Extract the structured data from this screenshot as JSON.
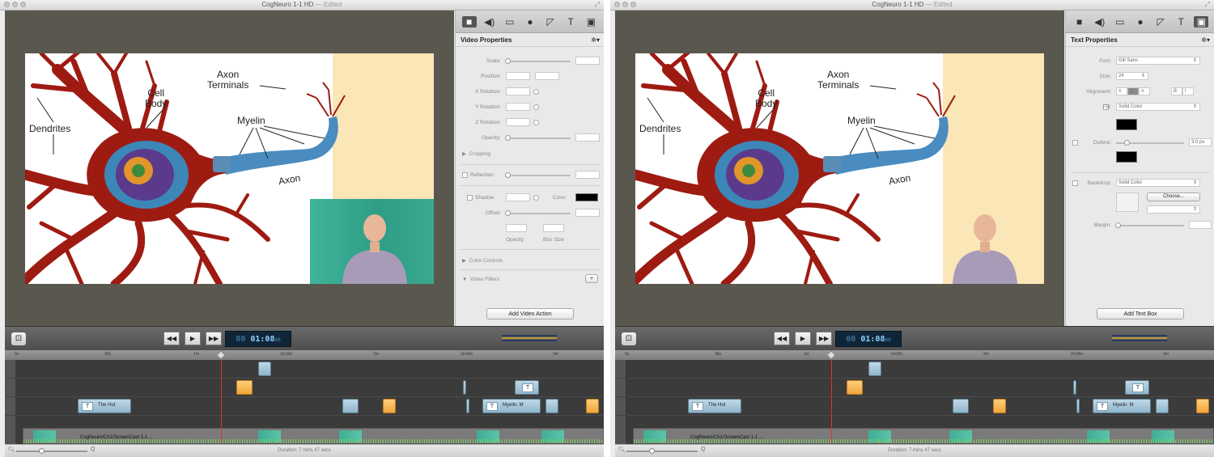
{
  "window": {
    "title": "CogNeuro 1-1 HD",
    "edited": "— Edited"
  },
  "slide": {
    "labels": {
      "dendrites": "Dendrites",
      "cell_body": "Cell\nBody",
      "axon_terminals": "Axon\nTerminals",
      "myelin": "Myelin",
      "axon": "Axon"
    }
  },
  "inspector_tabs": [
    "video-icon",
    "audio-icon",
    "screen-icon",
    "pointer-icon",
    "shape-icon",
    "text-icon",
    "media-icon"
  ],
  "video_properties": {
    "title": "Video Properties",
    "scale": "Scale:",
    "position": "Position:",
    "x_rotation": "X Rotation:",
    "y_rotation": "Y Rotation:",
    "z_rotation": "Z Rotation:",
    "opacity": "Opacity:",
    "cropping": "Cropping",
    "reflection": "Reflection",
    "shadow": "Shadow",
    "color": "Color:",
    "offset": "Offset:",
    "opacity_sub": "Opacity",
    "blur_size": "Blur Size",
    "color_controls": "Color Controls",
    "video_filters": "Video Filters",
    "add_action": "Add Video Action"
  },
  "text_properties": {
    "title": "Text Properties",
    "font_label": "Font:",
    "font_value": "Gill Sans",
    "size_label": "Size:",
    "size_value": "24",
    "alignment_label": "Alignment:",
    "fill_label": "Fill:",
    "fill_value": "Solid Color",
    "outline_label": "Outline:",
    "outline_value": "3.0 px",
    "backdrop_label": "Backdrop:",
    "backdrop_value": "Solid Color",
    "choose": "Choose...",
    "margin_label": "Margin:",
    "add_text_box": "Add Text Box"
  },
  "transport": {
    "timecode_dim": "00",
    "timecode": "01:08",
    "frames": "00"
  },
  "ruler_ticks": [
    "0s",
    "30s",
    "1m",
    "1m30s",
    "2m",
    "2m30s",
    "3m"
  ],
  "clips": {
    "title_a": "The Hut",
    "title_b": "Myelin: M",
    "main": "CogNeuro/Ch1/ScreenCast 1-1 ..."
  },
  "status": {
    "duration": "Duration: 7 mins 47 secs"
  }
}
